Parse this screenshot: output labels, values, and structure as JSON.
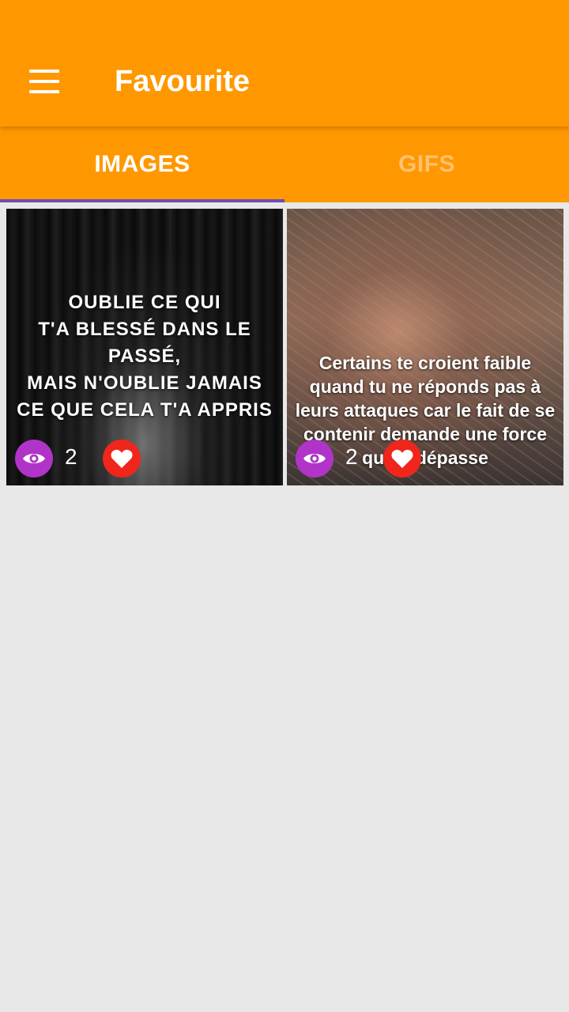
{
  "appbar": {
    "title": "Favourite",
    "menu_icon": "menu-icon"
  },
  "tabs": [
    {
      "label": "IMAGES",
      "active": true
    },
    {
      "label": "GIFS",
      "active": false
    }
  ],
  "cards": [
    {
      "quote": "OUBLIE CE QUI\nT'A BLESSÉ DANS LE PASSÉ,\nMAIS N'OUBLIE JAMAIS\nCE QUE CELA T'A APPRIS",
      "views": "2",
      "view_icon": "eye-icon",
      "fav_icon": "heart-icon"
    },
    {
      "quote": "Certains te croient faible\nquand tu ne réponds pas à\nleurs attaques car le fait de se\ncontenir demande une force\nqui te dépasse",
      "views": "2",
      "view_icon": "eye-icon",
      "fav_icon": "heart-icon"
    }
  ],
  "colors": {
    "primary": "#ff9800",
    "tab_indicator": "#6e4bb3",
    "view_button": "#b134c9",
    "favorite_button": "#f0261c",
    "background": "#e8e8e8"
  }
}
